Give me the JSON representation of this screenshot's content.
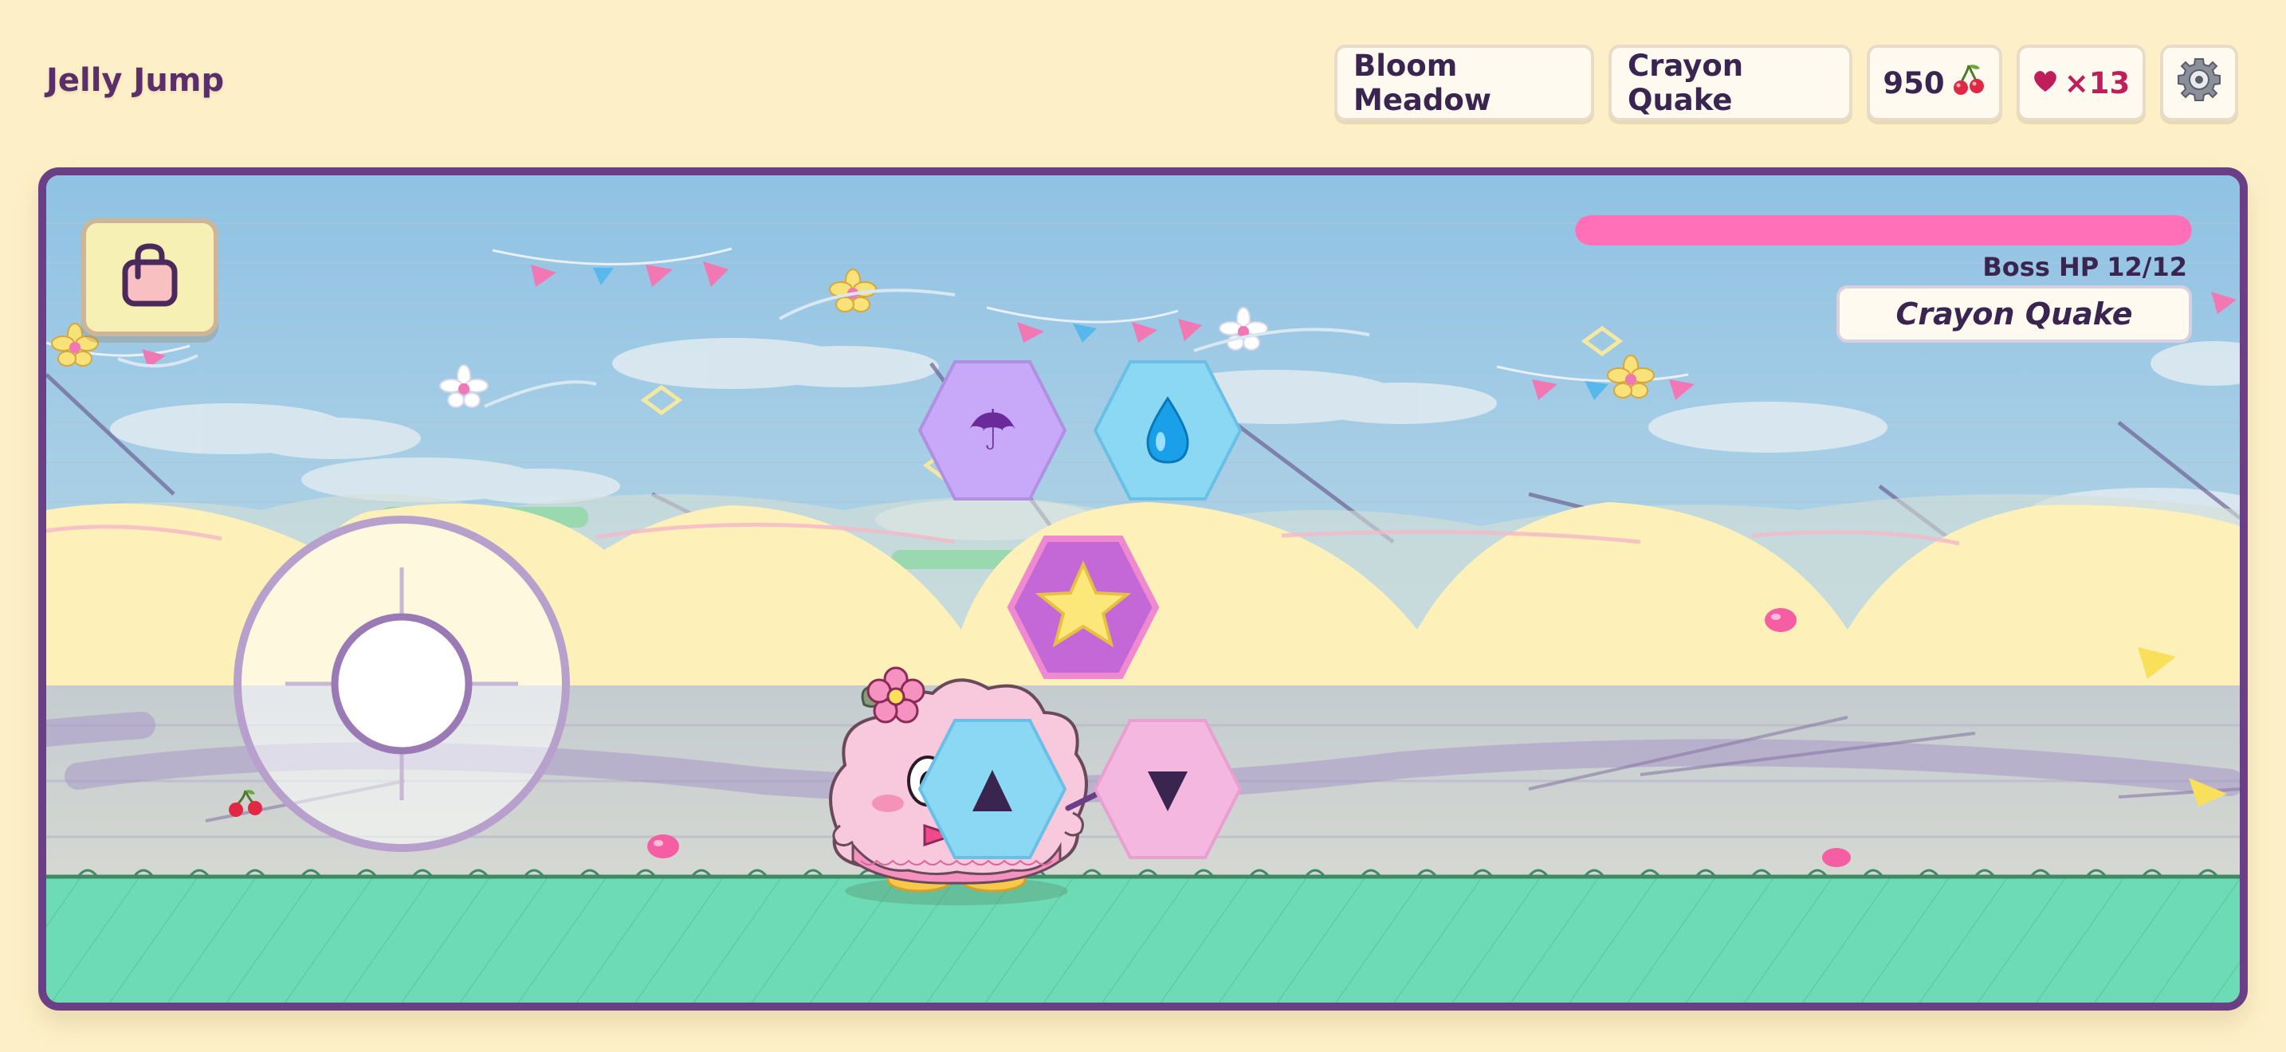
{
  "app": {
    "title": "Jelly Jump"
  },
  "hud": {
    "level": "Bloom Meadow",
    "boss_label": "Crayon Quake",
    "score": "950",
    "score_icon": "cherry-icon",
    "lives": "×13",
    "lives_icon": "heart-icon",
    "settings_icon": "gear-icon"
  },
  "boss": {
    "hp_label": "Boss HP",
    "hp_text": "12/12",
    "hp_fraction": 1.0,
    "name": "Crayon Quake",
    "bar_color": "#ff70b8"
  },
  "controls": {
    "pause_icon": "bag-icon",
    "joystick": "virtual-joystick",
    "umbrella": {
      "icon": "umbrella-icon",
      "glyph": "☂",
      "color": "#c8a8f8"
    },
    "drop": {
      "icon": "water-drop-icon",
      "color": "#8ad8f4"
    },
    "star": {
      "icon": "star-icon",
      "color": "#c468d8"
    },
    "jump": {
      "icon": "up-arrow-icon",
      "color": "#8ad8f4"
    },
    "duck": {
      "icon": "down-arrow-icon",
      "color": "#f4b8e0"
    }
  },
  "colors": {
    "frame": "#6a3f86",
    "ground": "#6ddcb6",
    "sky": "#9ec8e2",
    "hills": "#fdf0b8",
    "player": "#f8c8dc"
  },
  "player": {
    "name": "pink cloud jelly with flower and star wand"
  }
}
